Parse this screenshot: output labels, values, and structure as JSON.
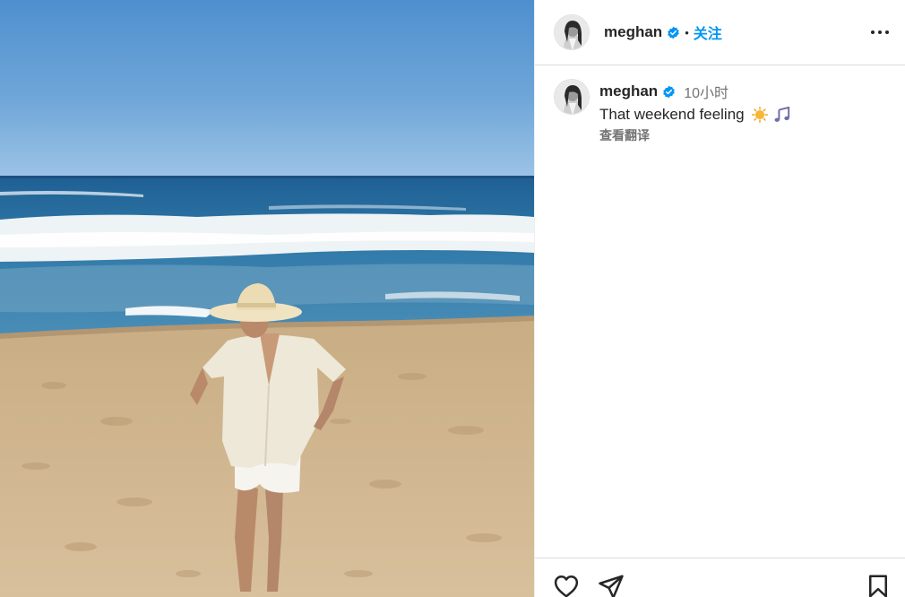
{
  "post": {
    "username": "meghan",
    "verified": true,
    "separator": "•",
    "follow_label": "关注",
    "more_icon": "more-horizontal-icon"
  },
  "caption": {
    "username": "meghan",
    "time": "10小时",
    "text": "That weekend feeling",
    "emojis": [
      "sun-emoji",
      "music-notes-emoji"
    ],
    "translate_label": "查看翻译"
  },
  "actions": {
    "like_icon": "heart-icon",
    "share_icon": "send-icon",
    "save_icon": "bookmark-icon"
  },
  "colors": {
    "accent": "#0095f6",
    "verified": "#0095f6",
    "text": "#262626",
    "muted": "#737373"
  }
}
